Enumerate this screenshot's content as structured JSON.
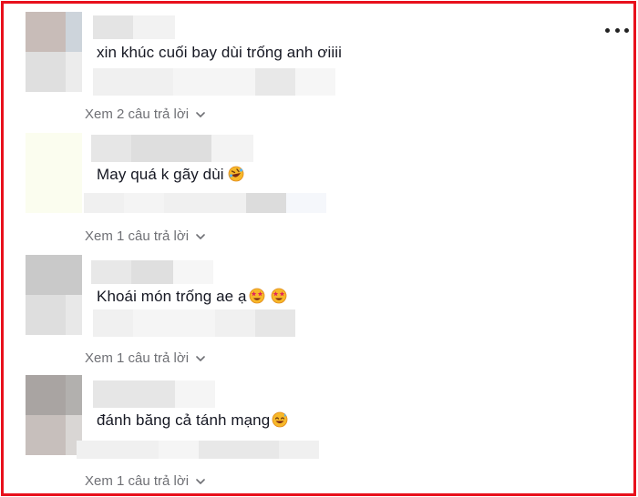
{
  "comments": [
    {
      "text": "xin khúc cuối bay dùi trống anh ơiiii",
      "replies_label": "Xem 2 câu trả lời",
      "emojis": []
    },
    {
      "text": "May quá k gãy dùi",
      "replies_label": "Xem 1 câu trả lời",
      "emojis": [
        "rolling-laughing-emoji"
      ]
    },
    {
      "text": "Khoái món trống ae ạ",
      "replies_label": "Xem 1 câu trả lời",
      "emojis": [
        "star-struck-emoji",
        "star-struck-emoji"
      ]
    },
    {
      "text": "đánh băng cả tánh mạng",
      "replies_label": "Xem 1 câu trả lời",
      "emojis": [
        "sweat-smile-emoji"
      ]
    }
  ],
  "colors": {
    "border": "#e8101c",
    "text": "#161823",
    "muted": "#6f7075"
  },
  "icons": {
    "more": "more-options-icon",
    "chevron": "chevron-down-icon"
  }
}
